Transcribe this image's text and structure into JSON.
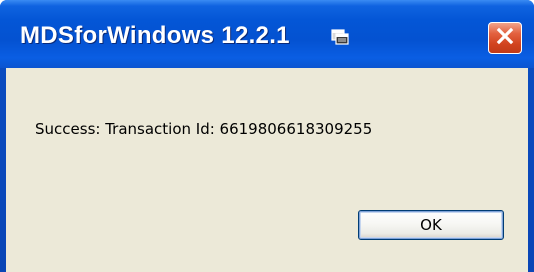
{
  "dialog": {
    "title": "MDSforWindows 12.2.1",
    "message": "Success: Transaction Id: 6619806618309255",
    "ok_label": "OK",
    "icons": {
      "title_icon": "window-restore-icon",
      "close_icon": "close-icon"
    },
    "colors": {
      "titlebar": "#0a55d2",
      "close_button": "#d9532f",
      "client_background": "#ece9d8"
    }
  }
}
